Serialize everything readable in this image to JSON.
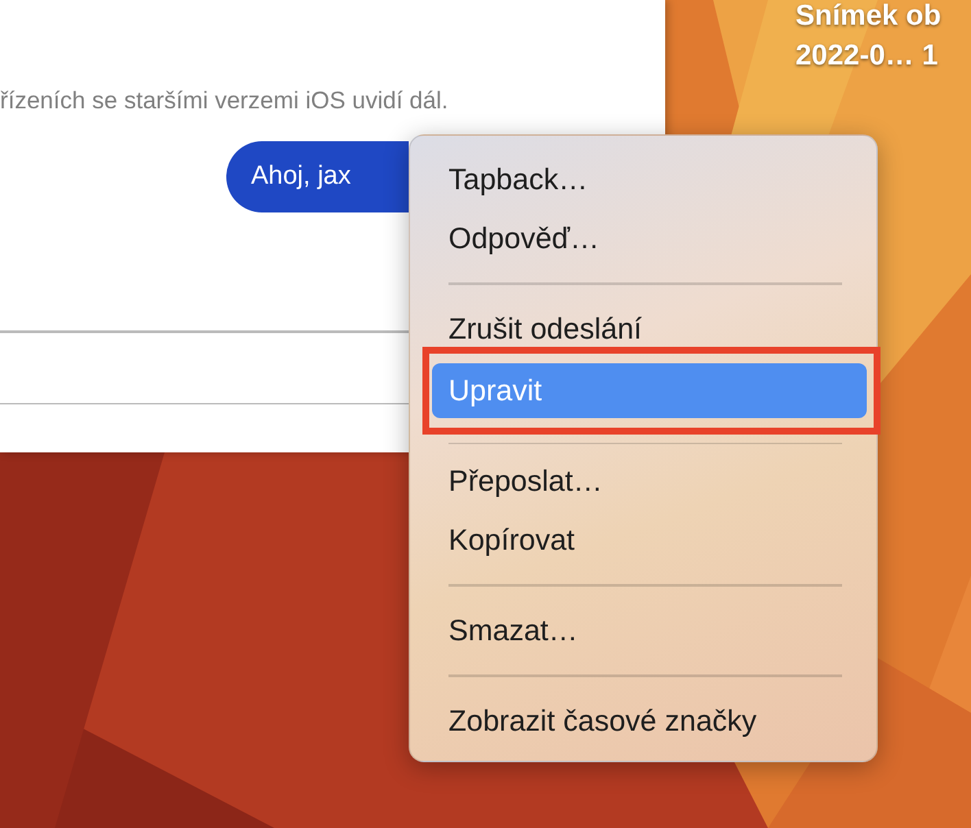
{
  "chat_window": {
    "notice": "řízeních se staršími verzemi iOS uvidí dál.",
    "message": {
      "text": "Ahoj, jax"
    }
  },
  "desktop_file": {
    "name": "Snímek ob",
    "date": "2022-0… 1"
  },
  "context_menu": {
    "items": [
      {
        "kind": "item",
        "label": "Tapback…",
        "selected": false,
        "annotated": false
      },
      {
        "kind": "item",
        "label": "Odpověď…",
        "selected": false,
        "annotated": false
      },
      {
        "kind": "separator"
      },
      {
        "kind": "item",
        "label": "Zrušit odeslání",
        "selected": false,
        "annotated": false
      },
      {
        "kind": "item",
        "label": "Upravit",
        "selected": true,
        "annotated": true
      },
      {
        "kind": "separator"
      },
      {
        "kind": "item",
        "label": "Přeposlat…",
        "selected": false,
        "annotated": false
      },
      {
        "kind": "item",
        "label": "Kopírovat",
        "selected": false,
        "annotated": false
      },
      {
        "kind": "separator"
      },
      {
        "kind": "item",
        "label": "Smazat…",
        "selected": false,
        "annotated": false
      },
      {
        "kind": "separator"
      },
      {
        "kind": "item",
        "label": "Zobrazit časové značky",
        "selected": false,
        "annotated": false
      }
    ]
  }
}
